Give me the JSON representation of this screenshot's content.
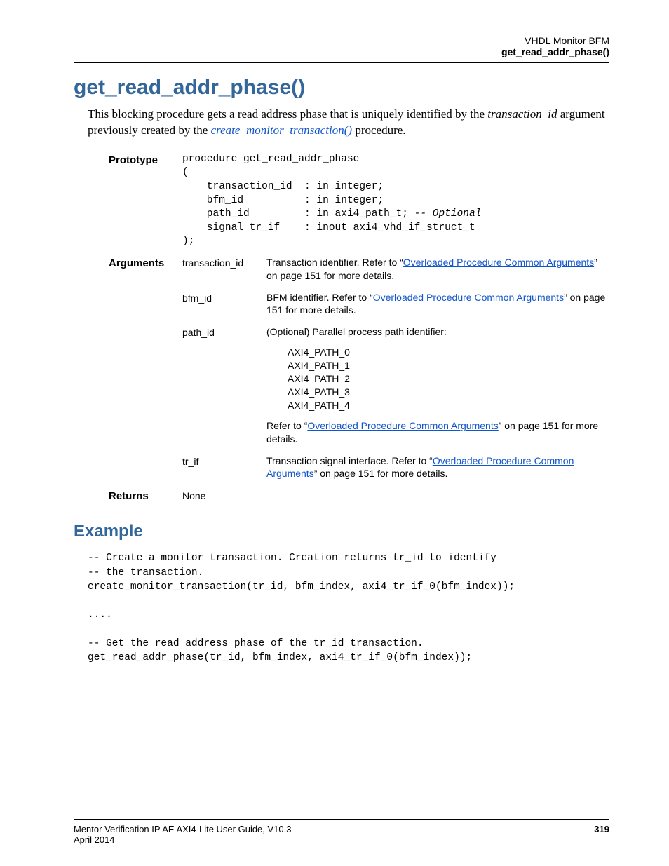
{
  "header": {
    "line1": "VHDL Monitor BFM",
    "line2": "get_read_addr_phase()"
  },
  "title": "get_read_addr_phase()",
  "intro": {
    "part1": "This blocking procedure gets a read address phase that is uniquely identified by the ",
    "italic1": "transaction_id",
    "part2": " argument previously created by the ",
    "link1": "create_monitor_transaction()",
    "part3": " procedure."
  },
  "prototype": {
    "label": "Prototype",
    "line1": "procedure get_read_addr_phase",
    "line2": "(",
    "line3": "    transaction_id  : in integer;",
    "line4": "    bfm_id          : in integer;",
    "line5a": "    path_id         : in axi4_path_t; ",
    "line5b": "-- Optional",
    "line6": "    signal tr_if    : inout axi4_vhd_if_struct_t",
    "line7": ");"
  },
  "arguments": {
    "label": "Arguments",
    "items": [
      {
        "name": "transaction_id",
        "desc_pre": "Transaction identifier. Refer to “",
        "desc_link": "Overloaded Procedure Common Arguments",
        "desc_post": "” on page 151 for more details."
      },
      {
        "name": "bfm_id",
        "desc_pre": "BFM identifier. Refer to “",
        "desc_link": "Overloaded Procedure Common Arguments",
        "desc_post": "” on page 151 for more details."
      },
      {
        "name": "path_id",
        "desc_pre": "(Optional) Parallel process path identifier:",
        "paths": [
          "AXI4_PATH_0",
          "AXI4_PATH_1",
          "AXI4_PATH_2",
          "AXI4_PATH_3",
          "AXI4_PATH_4"
        ],
        "desc2_pre": "Refer to “",
        "desc2_link": "Overloaded Procedure Common Arguments",
        "desc2_post": "” on page 151 for more details."
      },
      {
        "name": "tr_if",
        "desc_pre": "Transaction signal interface. Refer to “",
        "desc_link": "Overloaded Procedure Common Arguments",
        "desc_post": "” on page 151 for more details."
      }
    ]
  },
  "returns": {
    "label": "Returns",
    "value": "None"
  },
  "example": {
    "heading": "Example",
    "code": "-- Create a monitor transaction. Creation returns tr_id to identify\n-- the transaction.\ncreate_monitor_transaction(tr_id, bfm_index, axi4_tr_if_0(bfm_index));\n\n....\n\n-- Get the read address phase of the tr_id transaction.\nget_read_addr_phase(tr_id, bfm_index, axi4_tr_if_0(bfm_index));"
  },
  "footer": {
    "left": "Mentor Verification IP AE AXI4-Lite User Guide, V10.3",
    "right": "319",
    "date": "April 2014"
  }
}
